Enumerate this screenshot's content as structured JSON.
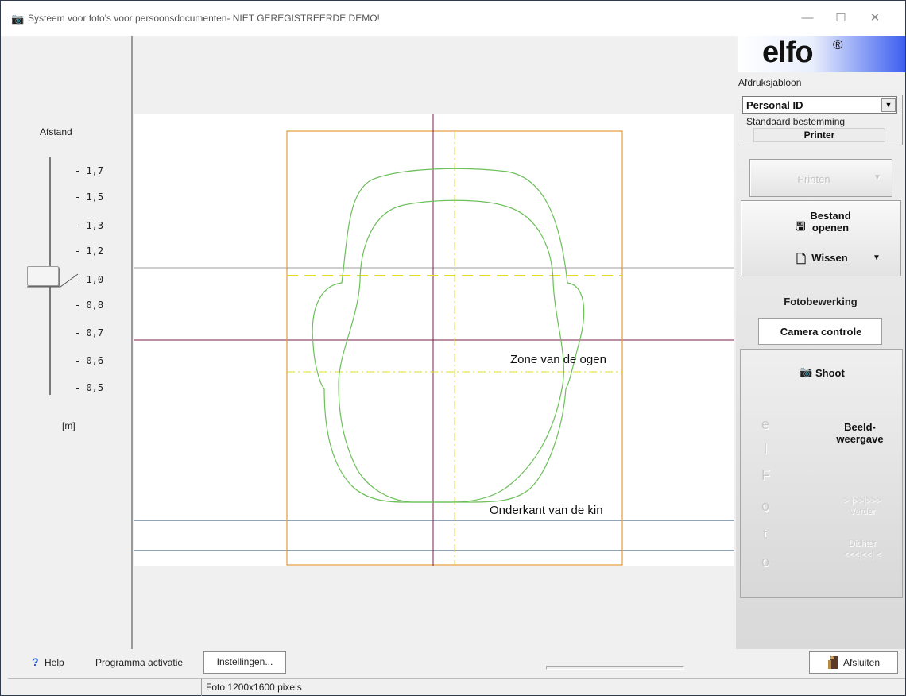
{
  "window": {
    "title": "Systeem voor foto's voor persoonsdocumenten- NIET GEREGISTREERDE DEMO!",
    "icon": "camera-icon",
    "controls": {
      "minimize": "—",
      "maximize": "☐",
      "close": "✕"
    }
  },
  "distance": {
    "title": "Afstand",
    "ticks": [
      "1,7",
      "1,5",
      "1,3",
      "1,2",
      "1,0",
      "0,8",
      "0,7",
      "0,6",
      "0,5"
    ],
    "current": "1,0",
    "unit": "[m]"
  },
  "overlay": {
    "eyes_zone_label": "Zone van de ogen",
    "chin_label": "Onderkant van de kin",
    "colors": {
      "frame": "#e39a3b",
      "face_outline": "#6cbf5a",
      "dashed_guide": "#e2de2b",
      "center_line": "#7a1f4a",
      "eye_line": "#7a1f4a",
      "gray_line": "#9e9e9e",
      "chin_line": "#2a4a66"
    }
  },
  "right": {
    "logo": "elfo",
    "logo_mark": "®",
    "template_label": "Afdruksjabloon",
    "template_value": "Personal ID",
    "dest_label": "Standaard bestemming",
    "dest_value": "Printer",
    "print_label": "Printen",
    "open_file_label_1": "Bestand",
    "open_file_label_2": "openen",
    "clear_label": "Wissen",
    "photo_edit_label": "Fotobewerking",
    "camera_control_label": "Camera controle",
    "shoot_label": "Shoot",
    "view_label_1": "Beeld-",
    "view_label_2": "weergave",
    "next_arrows": "> |>>|>>>",
    "next_label": "Verder",
    "closer_label": "Dichter",
    "closer_arrows": "<<<|<<| <",
    "efoto_letters": [
      "e",
      "l",
      "F",
      "o",
      "t",
      "o"
    ]
  },
  "bottom": {
    "help": "Help",
    "activation": "Programma activatie",
    "settings": "Instellingen...",
    "exit": "Afsluiten"
  },
  "status": {
    "photo_info": "Foto 1200x1600 pixels"
  }
}
